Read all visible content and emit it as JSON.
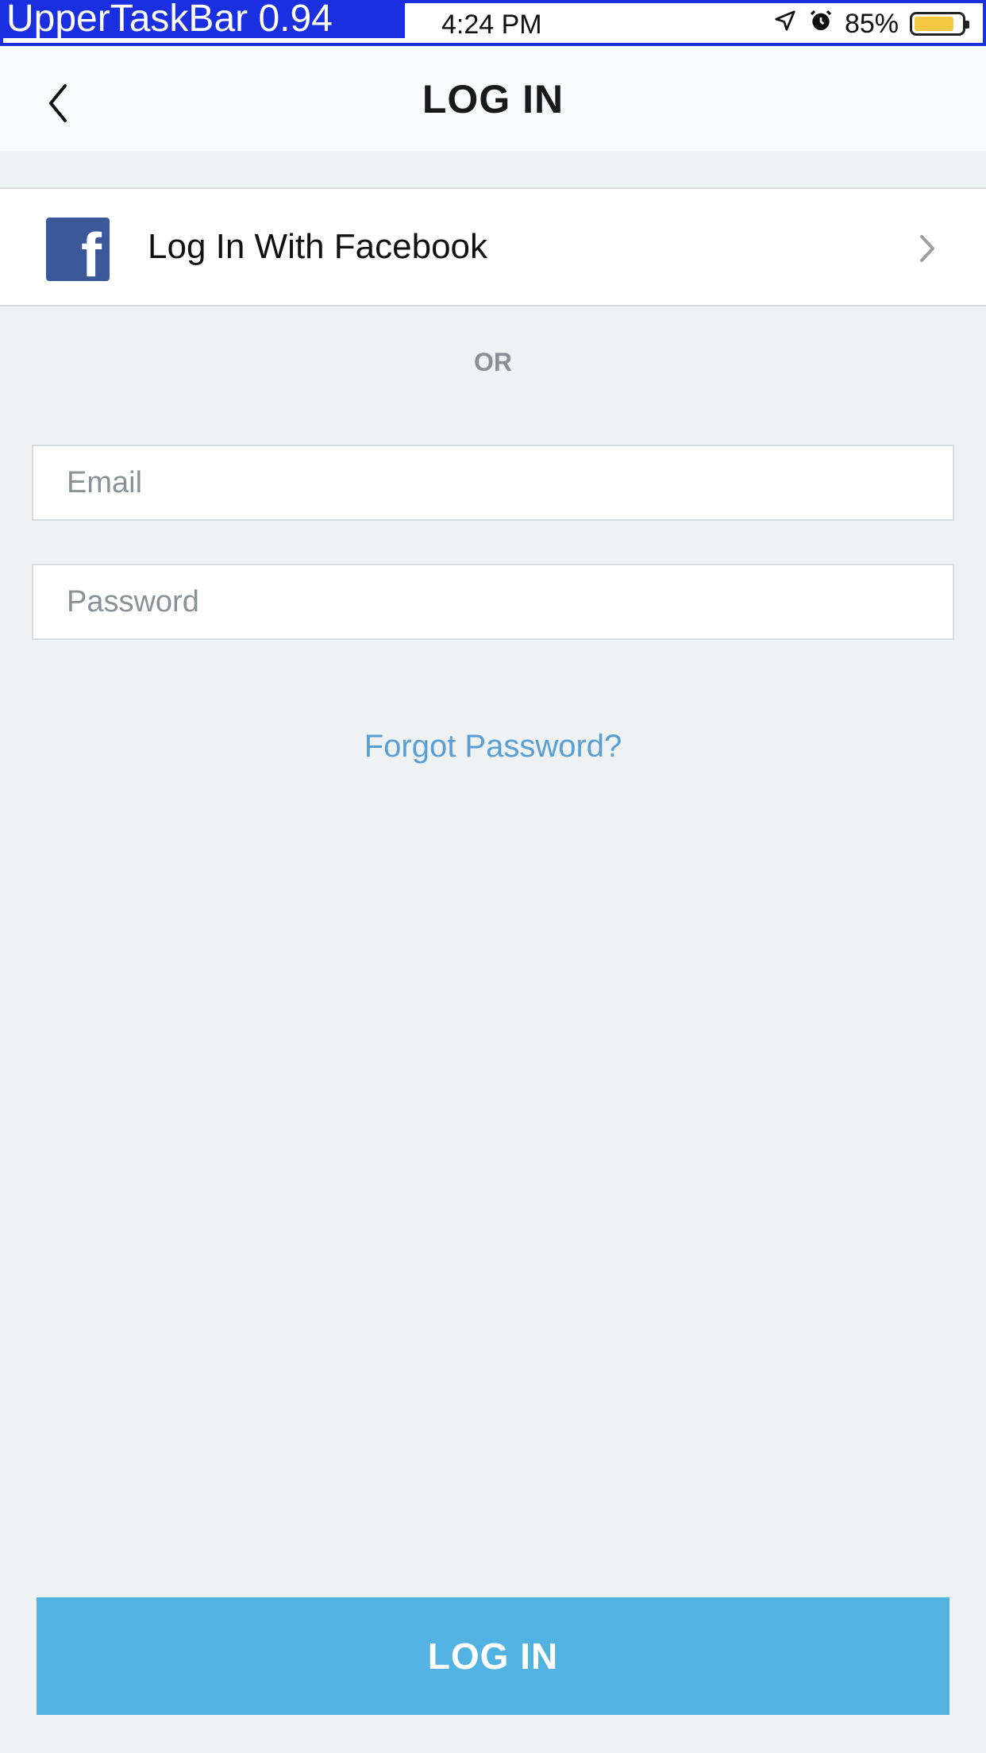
{
  "status_bar": {
    "carrier": "UpperTaskBar 0.94",
    "time": "4:24 PM",
    "battery_percent": "85%",
    "battery_level": 0.85,
    "location_icon": "location-arrow-icon",
    "alarm_icon": "alarm-clock-icon"
  },
  "nav": {
    "back_icon": "chevron-left-icon",
    "title": "LOG IN"
  },
  "facebook": {
    "icon": "facebook-icon",
    "label": "Log In With Facebook",
    "chevron_icon": "chevron-right-icon"
  },
  "divider_text": "OR",
  "form": {
    "email_placeholder": "Email",
    "password_placeholder": "Password"
  },
  "forgot_password": "Forgot Password?",
  "login_button": "LOG IN",
  "colors": {
    "accent": "#52b3e3",
    "link": "#5a9fd4",
    "facebook": "#3b5998",
    "background": "#eff2f3"
  }
}
